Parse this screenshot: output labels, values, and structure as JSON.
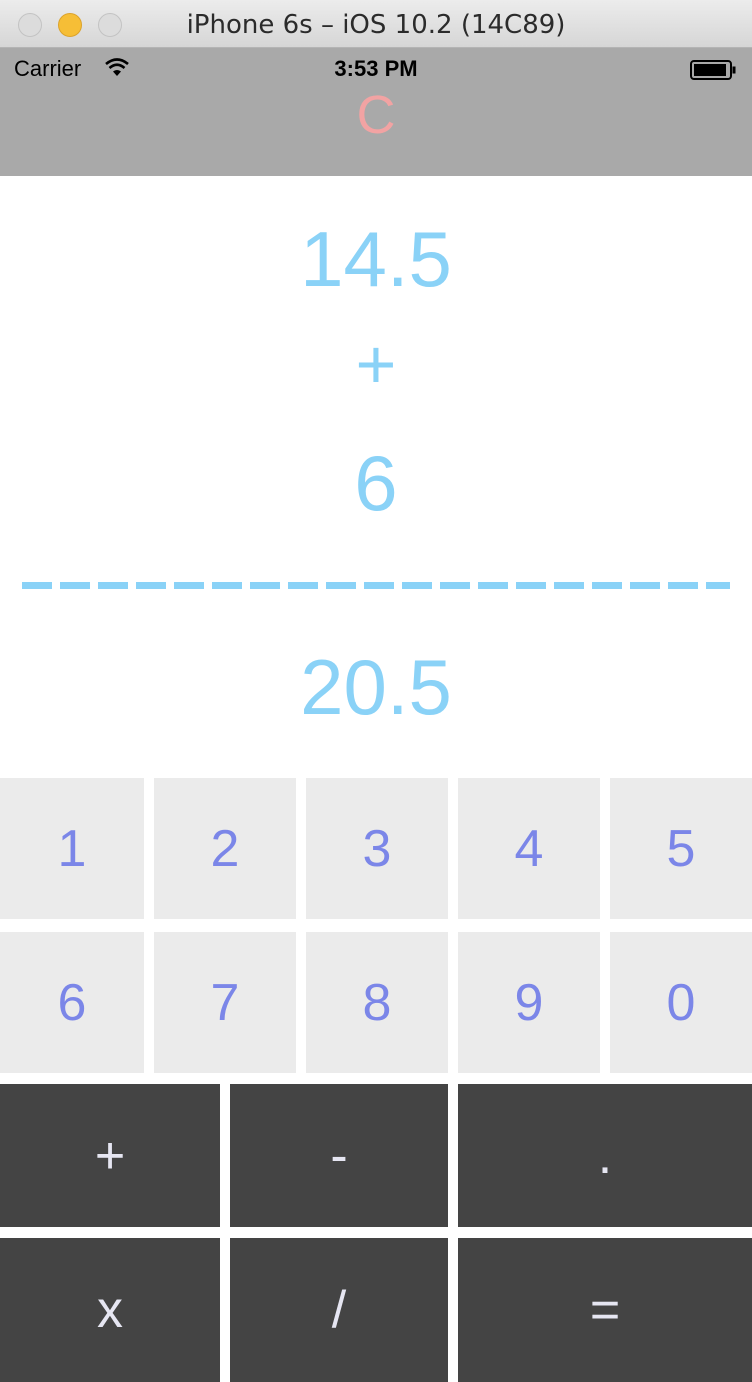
{
  "window": {
    "title": "iPhone 6s – iOS 10.2 (14C89)"
  },
  "status_bar": {
    "carrier": "Carrier",
    "time": "3:53 PM"
  },
  "header": {
    "clear_label": "C"
  },
  "display": {
    "operand1": "14.5",
    "operator": "+",
    "operand2": "6",
    "result": "20.5"
  },
  "keypad": {
    "digits_row1": [
      "1",
      "2",
      "3",
      "4",
      "5"
    ],
    "digits_row2": [
      "6",
      "7",
      "8",
      "9",
      "0"
    ],
    "ops_row1": [
      "+",
      "-",
      "."
    ],
    "ops_row2": [
      "x",
      "/",
      "="
    ]
  },
  "colors": {
    "display_text": "#8ad2f7",
    "digit_text": "#7b86e8",
    "digit_bg": "#ebebeb",
    "op_bg": "#444444",
    "clear_text": "#f2a3a3",
    "header_bg": "#a9a9a9"
  },
  "icons": [
    "wifi-icon",
    "battery-icon"
  ]
}
